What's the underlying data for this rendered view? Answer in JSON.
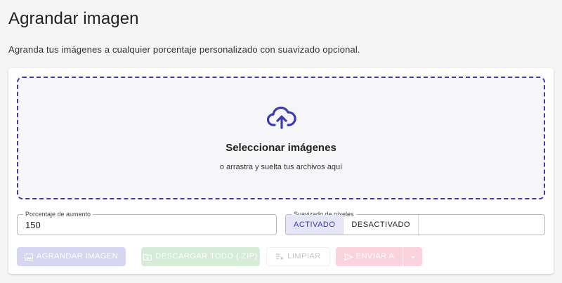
{
  "page": {
    "title": "Agrandar imagen",
    "subtitle": "Agranda tus imágenes a cualquier porcentaje personalizado con suavizado opcional."
  },
  "dropzone": {
    "title": "Seleccionar imágenes",
    "subtitle": "o arrastra y suelta tus archivos aquí",
    "icon": "cloud-upload-icon"
  },
  "percent_field": {
    "label": "Porcentaje de aumento",
    "value": "150"
  },
  "smoothing": {
    "label": "Suavizado de píxeles",
    "options": [
      "ACTIVADO",
      "DESACTIVADO"
    ],
    "selected": "ACTIVADO"
  },
  "actions": {
    "enlarge_label": "AGRANDAR IMAGEN",
    "download_label": "DESCARGAR TODO (.ZIP)",
    "clear_label": "LIMPIAR",
    "send_label": "ENVIAR A"
  },
  "colors": {
    "accent": "#3c3cae",
    "enlarge_disabled": "#d6d6f0",
    "download_disabled": "#d6ecd8",
    "send_disabled": "#fbd3de"
  }
}
